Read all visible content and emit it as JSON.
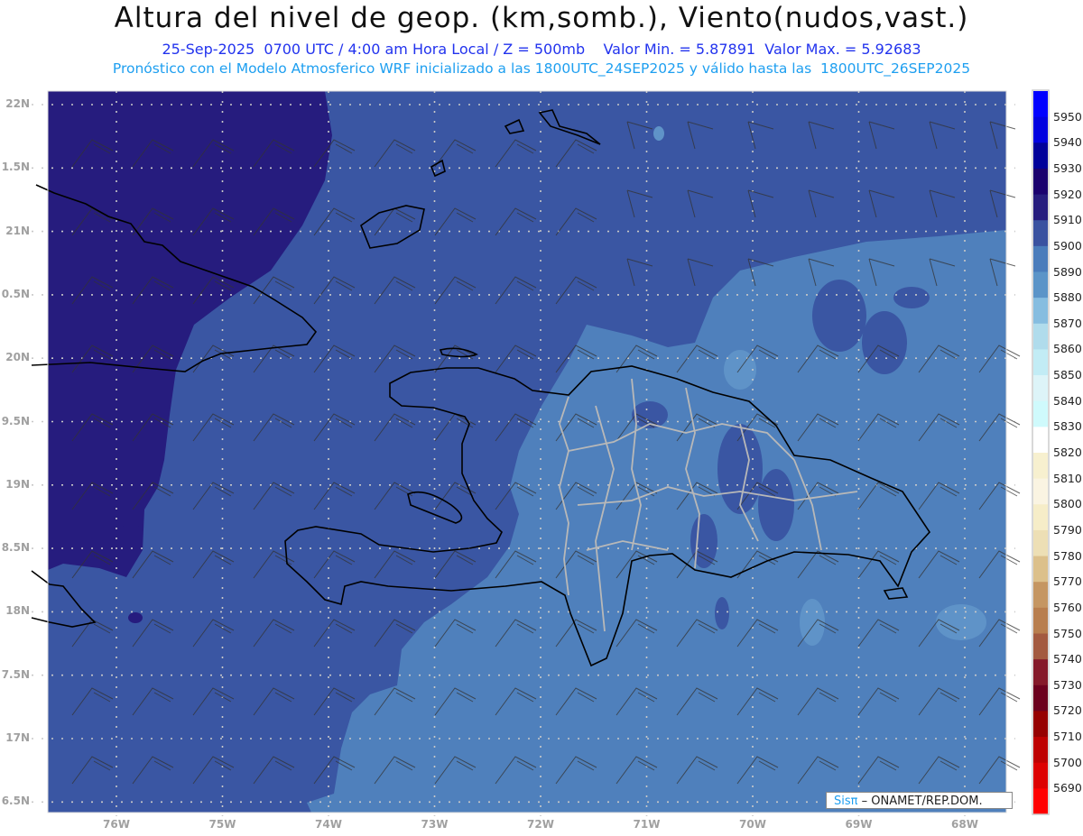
{
  "title": "Altura del nivel de geop. (km,somb.), Viento(nudos,vast.)",
  "subtitle": "25-Sep-2025  0700 UTC / 4:00 am Hora Local / Z = 500mb    Valor Min. = 5.87891  Valor Max. = 5.92683",
  "model_line": "Pronóstico con el Modelo Atmosferico WRF inicializado a las 1800UTC_24SEP2025 y válido hasta las  1800UTC_26SEP2025",
  "lat_labels": [
    "22N",
    "1.5N",
    "21N",
    "0.5N",
    "20N",
    "9.5N",
    "19N",
    "8.5N",
    "18N",
    "7.5N",
    "17N",
    "6.5N"
  ],
  "lon_labels": [
    "76W",
    "75W",
    "74W",
    "73W",
    "72W",
    "71W",
    "70W",
    "69W",
    "68W"
  ],
  "colorbar": {
    "labels": [
      "5950",
      "5940",
      "5930",
      "5920",
      "5910",
      "5900",
      "5890",
      "5880",
      "5870",
      "5860",
      "5850",
      "5840",
      "5830",
      "5820",
      "5810",
      "5800",
      "5790",
      "5780",
      "5770",
      "5760",
      "5750",
      "5740",
      "5730",
      "5720",
      "5710",
      "5700",
      "5690"
    ],
    "colors": [
      "#0000ff",
      "#0000e0",
      "#00009a",
      "#1a006e",
      "#261c7e",
      "#3a52a0",
      "#4a7cbb",
      "#5b94c8",
      "#86bde0",
      "#b0dcec",
      "#c2ecf5",
      "#ddf4f8",
      "#cffafc",
      "#ffffff",
      "#f7f0cf",
      "#faf4e2",
      "#f6edc8",
      "#eddfb5",
      "#dcc08b",
      "#c59662",
      "#b87e4e",
      "#a35a40",
      "#85192a",
      "#6c001e",
      "#960000",
      "#be0000",
      "#dd0000",
      "#ff0000"
    ]
  },
  "credit": {
    "brand": "Sisπ",
    "text": " – ONAMET/REP.DOM."
  },
  "field_colors": {
    "high": "#261c7e",
    "mid": "#3a56a3",
    "low": "#4f80bc",
    "lower": "#5f93c8"
  }
}
